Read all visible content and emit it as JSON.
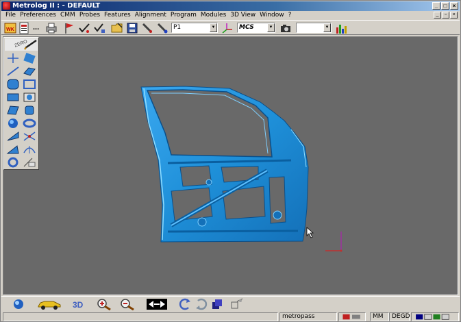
{
  "window": {
    "title": "Metrolog II : - DEFAULT",
    "buttons": [
      "_",
      "□",
      "×"
    ]
  },
  "menubar": {
    "items": [
      "File",
      "Preferences",
      "CMM",
      "Probes",
      "Features",
      "Alignment",
      "Program",
      "Modules",
      "3D View",
      "Window",
      "?"
    ],
    "mdi_buttons": [
      "_",
      "▫",
      "×"
    ]
  },
  "toolbar": {
    "ellipsis": "...",
    "probe_combo": "P1",
    "frame_combo": "MCS",
    "extra_combo": "",
    "wk_label": "WK"
  },
  "palette": {
    "header_text": "ZERO"
  },
  "statusbar": {
    "message": "",
    "profile": "metropass",
    "units": "MM",
    "angle_units": "DEGD"
  },
  "colors": {
    "viewport": "#696969",
    "part": "#1e8fd8",
    "axis_x": "#c03030",
    "axis_y": "#a030a0"
  }
}
